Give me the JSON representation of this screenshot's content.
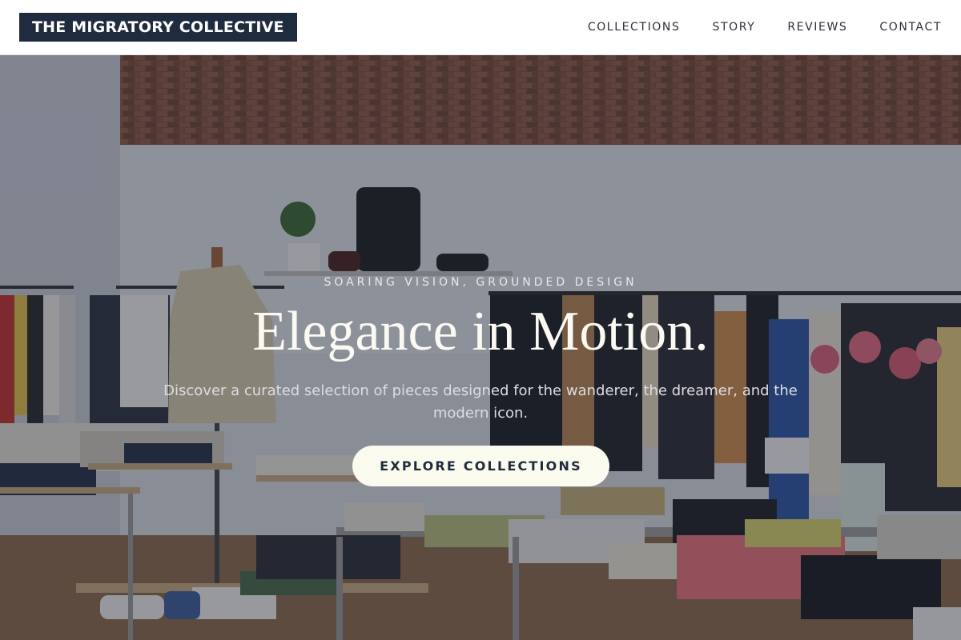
{
  "header": {
    "brand": "THE MIGRATORY COLLECTIVE",
    "nav": [
      {
        "label": "COLLECTIONS"
      },
      {
        "label": "STORY"
      },
      {
        "label": "REVIEWS"
      },
      {
        "label": "CONTACT"
      }
    ]
  },
  "hero": {
    "eyebrow": "SOARING VISION, GROUNDED DESIGN",
    "title": "Elegance in Motion.",
    "subtitle": "Discover a curated selection of pieces designed for the wanderer, the dreamer, and the modern icon.",
    "cta_label": "EXPLORE COLLECTIONS"
  },
  "colors": {
    "brand_navy": "#1f2b3e",
    "cta_cream": "#fbfaee",
    "overlay": "#1a1e2c"
  }
}
